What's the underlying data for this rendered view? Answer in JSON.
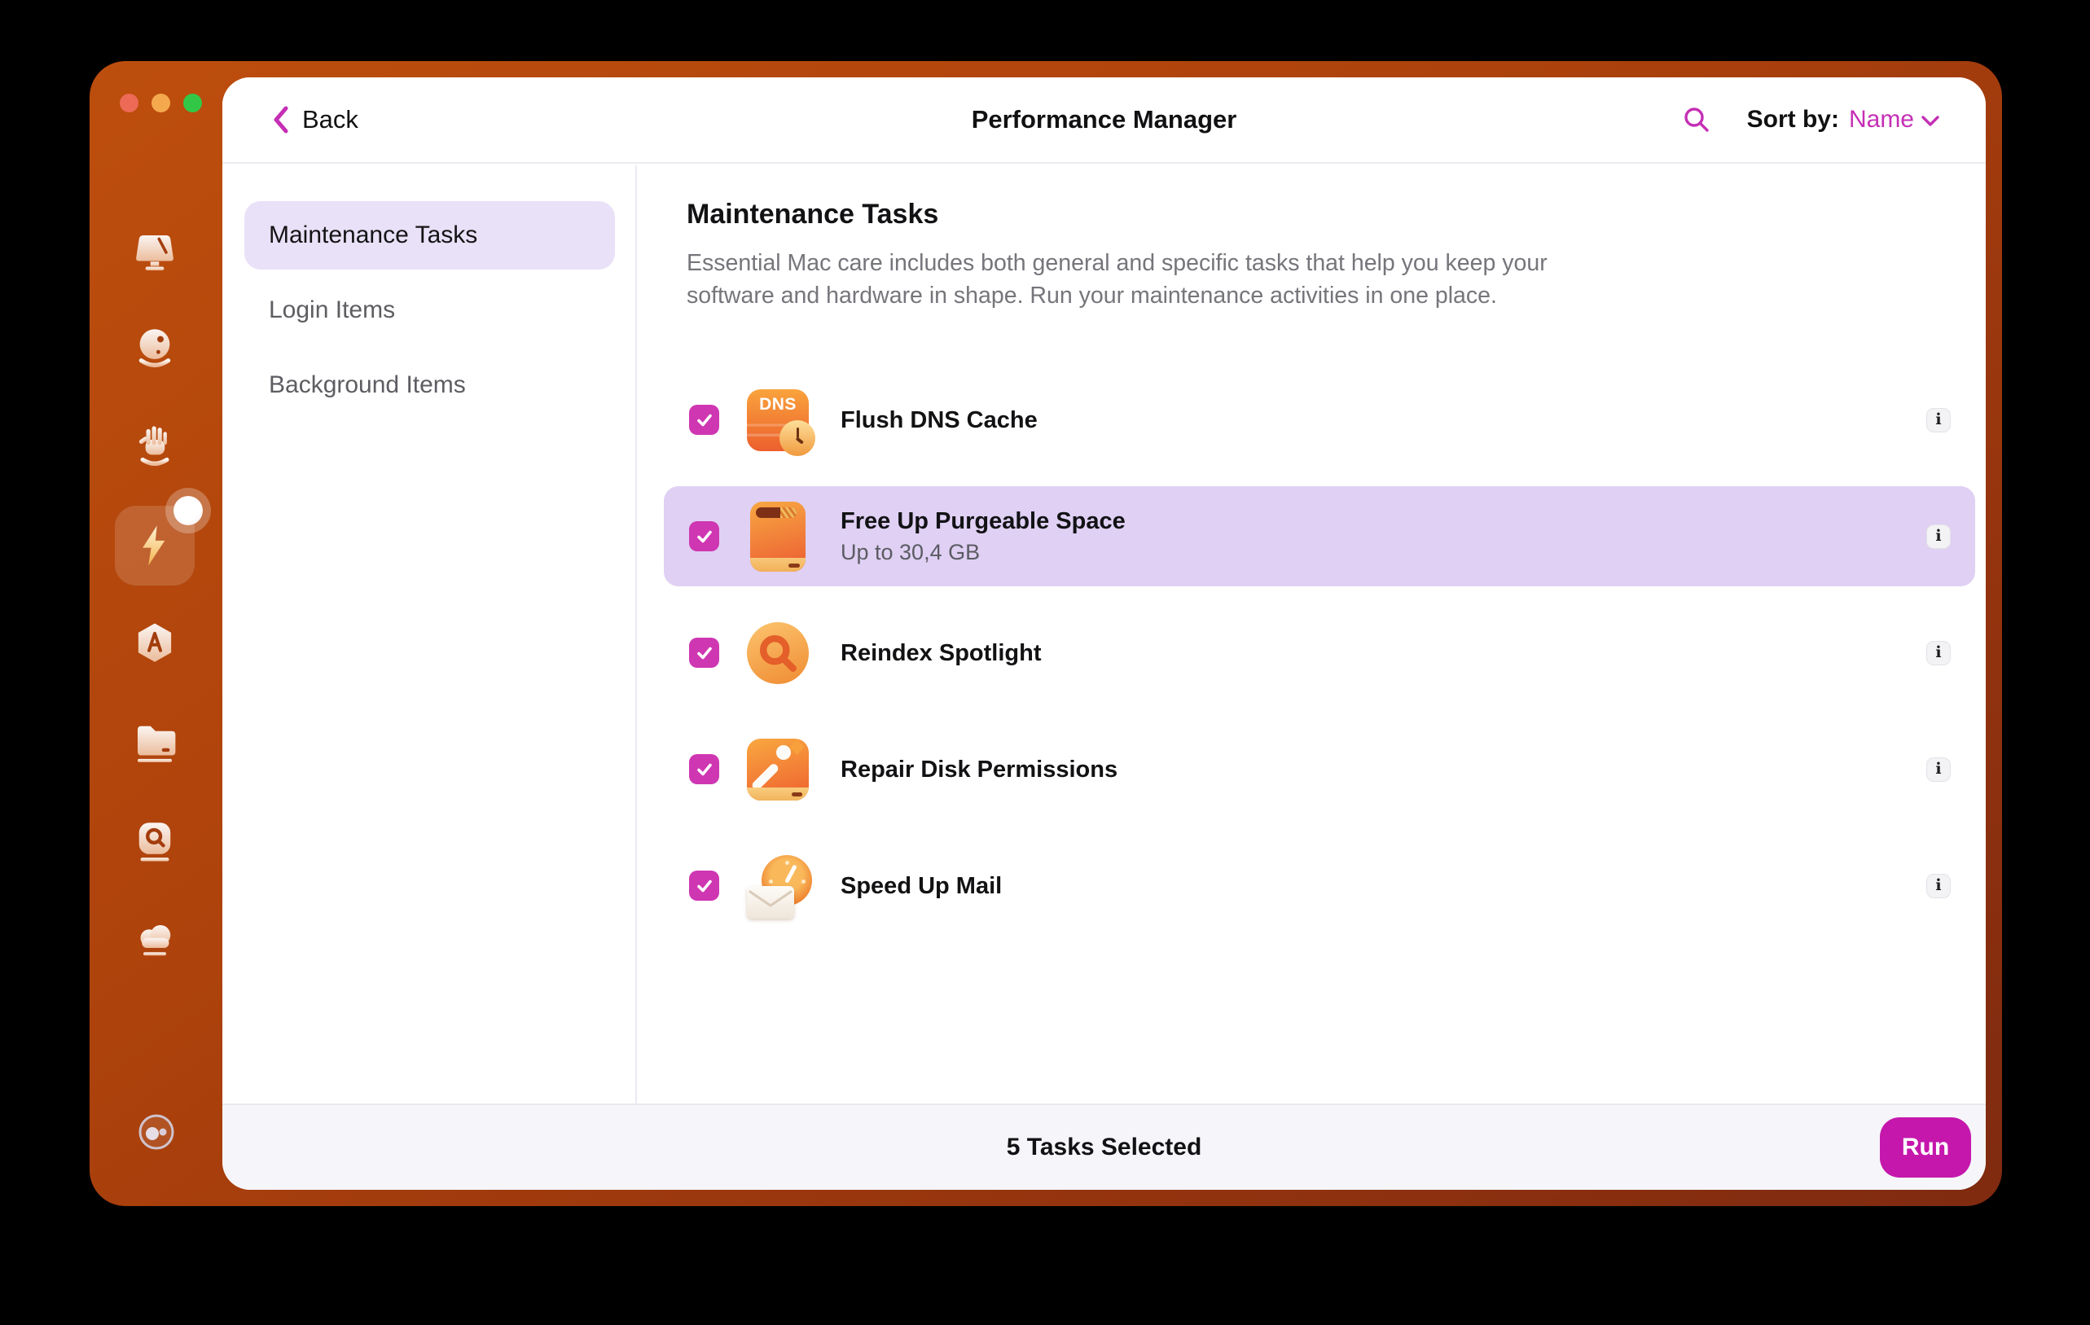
{
  "colors": {
    "accent_magenta": "#c52fb5",
    "checkbox_magenta": "#cf36b2",
    "run_button": "#c517ac",
    "selected_row_bg": "#dfd0f4",
    "nav_selected_bg": "#e9e1f7",
    "window_gradient_start": "#bd4e0d",
    "window_gradient_end": "#7f2a10",
    "footer_bg": "#f6f5f9",
    "traffic_red": "#ec6a56",
    "traffic_yellow": "#f4a94f",
    "traffic_green": "#33c748"
  },
  "header": {
    "back_label": "Back",
    "title": "Performance Manager",
    "sort_by_label": "Sort by:",
    "sort_value": "Name"
  },
  "rail": {
    "items": [
      {
        "icon": "display-icon",
        "selected": false
      },
      {
        "icon": "cleanup-ball-icon",
        "selected": false
      },
      {
        "icon": "protection-hand-icon",
        "selected": false
      },
      {
        "icon": "performance-lightning-icon",
        "selected": true,
        "badge": true
      },
      {
        "icon": "applications-icon",
        "selected": false
      },
      {
        "icon": "files-folder-icon",
        "selected": false
      },
      {
        "icon": "space-lens-icon",
        "selected": false
      },
      {
        "icon": "storage-cloud-icon",
        "selected": false
      },
      {
        "icon": "assistant-icon",
        "selected": false
      }
    ]
  },
  "sidebar": {
    "items": [
      {
        "label": "Maintenance Tasks",
        "selected": true
      },
      {
        "label": "Login Items",
        "selected": false
      },
      {
        "label": "Background Items",
        "selected": false
      }
    ]
  },
  "main": {
    "heading": "Maintenance Tasks",
    "description": "Essential Mac care includes both general and specific tasks that help you keep your software and hardware in shape. Run your maintenance activities in one place.",
    "info_glyph": "i",
    "tasks": [
      {
        "label": "Flush DNS Cache",
        "icon": "dns-task-icon",
        "icon_text": "DNS",
        "checked": true,
        "selected": false
      },
      {
        "label": "Free Up Purgeable Space",
        "subtitle": "Up to 30,4 GB",
        "icon": "purgeable-disk-icon",
        "checked": true,
        "selected": true
      },
      {
        "label": "Reindex Spotlight",
        "icon": "spotlight-task-icon",
        "checked": true,
        "selected": false
      },
      {
        "label": "Repair Disk Permissions",
        "icon": "repair-disk-icon",
        "checked": true,
        "selected": false
      },
      {
        "label": "Speed Up Mail",
        "icon": "mail-speed-icon",
        "checked": true,
        "selected": false
      }
    ]
  },
  "footer": {
    "status": "5 Tasks Selected",
    "run_label": "Run"
  }
}
